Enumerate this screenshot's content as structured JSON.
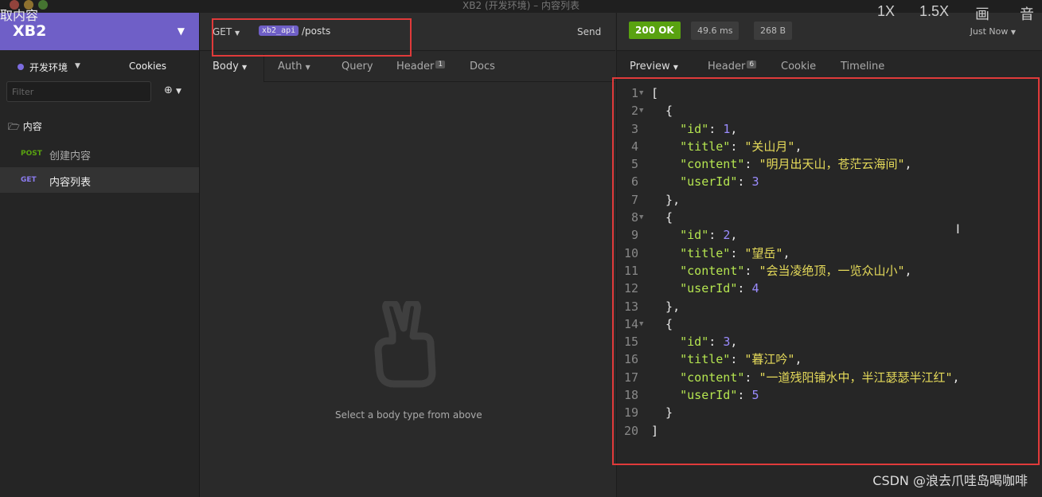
{
  "window": {
    "title": "XB2 (开发环境) – 内容列表",
    "overlay_text": "取内容",
    "video_controls": [
      "1X",
      "1.5X",
      "画",
      "音"
    ]
  },
  "sidebar": {
    "workspace": "XB2",
    "environment": "开发环境",
    "cookies_label": "Cookies",
    "filter_placeholder": "Filter",
    "folder": "内容",
    "requests": [
      {
        "method": "POST",
        "name": "创建内容",
        "method_color": "#59a210"
      },
      {
        "method": "GET",
        "name": "内容列表",
        "method_color": "#8c7cf0"
      }
    ]
  },
  "request": {
    "method": "GET",
    "env_tag": "xb2_api",
    "path": "/posts",
    "send_label": "Send",
    "tabs": [
      {
        "label": "Body"
      },
      {
        "label": "Auth"
      },
      {
        "label": "Query"
      },
      {
        "label": "Header",
        "badge": "1"
      },
      {
        "label": "Docs"
      }
    ],
    "empty_hint": "Select a body type from above"
  },
  "response": {
    "status": "200 OK",
    "time": "49.6 ms",
    "size": "268 B",
    "timestamp": "Just Now",
    "tabs": [
      {
        "label": "Preview"
      },
      {
        "label": "Header",
        "badge": "6"
      },
      {
        "label": "Cookie"
      },
      {
        "label": "Timeline"
      }
    ],
    "code_lines": [
      {
        "n": "1",
        "fold": true,
        "t": "["
      },
      {
        "n": "2",
        "fold": true,
        "t": "  {"
      },
      {
        "n": "3",
        "k": "id",
        "v": "1",
        "vt": "num",
        "comma": true
      },
      {
        "n": "4",
        "k": "title",
        "v": "\"关山月\"",
        "vt": "str",
        "comma": true
      },
      {
        "n": "5",
        "k": "content",
        "v": "\"明月出天山，苍茫云海间\"",
        "vt": "str",
        "comma": true
      },
      {
        "n": "6",
        "k": "userId",
        "v": "3",
        "vt": "num",
        "comma": false
      },
      {
        "n": "7",
        "t": "  },"
      },
      {
        "n": "8",
        "fold": true,
        "t": "  {"
      },
      {
        "n": "9",
        "k": "id",
        "v": "2",
        "vt": "num",
        "comma": true
      },
      {
        "n": "10",
        "k": "title",
        "v": "\"望岳\"",
        "vt": "str",
        "comma": true
      },
      {
        "n": "11",
        "k": "content",
        "v": "\"会当凌绝顶，一览众山小\"",
        "vt": "str",
        "comma": true
      },
      {
        "n": "12",
        "k": "userId",
        "v": "4",
        "vt": "num",
        "comma": false
      },
      {
        "n": "13",
        "t": "  },"
      },
      {
        "n": "14",
        "fold": true,
        "t": "  {"
      },
      {
        "n": "15",
        "k": "id",
        "v": "3",
        "vt": "num",
        "comma": true
      },
      {
        "n": "16",
        "k": "title",
        "v": "\"暮江吟\"",
        "vt": "str",
        "comma": true
      },
      {
        "n": "17",
        "k": "content",
        "v": "\"一道残阳铺水中，半江瑟瑟半江红\"",
        "vt": "str",
        "comma": true
      },
      {
        "n": "18",
        "k": "userId",
        "v": "5",
        "vt": "num",
        "comma": false
      },
      {
        "n": "19",
        "t": "  }"
      },
      {
        "n": "20",
        "t": "]"
      }
    ]
  },
  "watermark": "CSDN @浪去爪哇岛喝咖啡"
}
